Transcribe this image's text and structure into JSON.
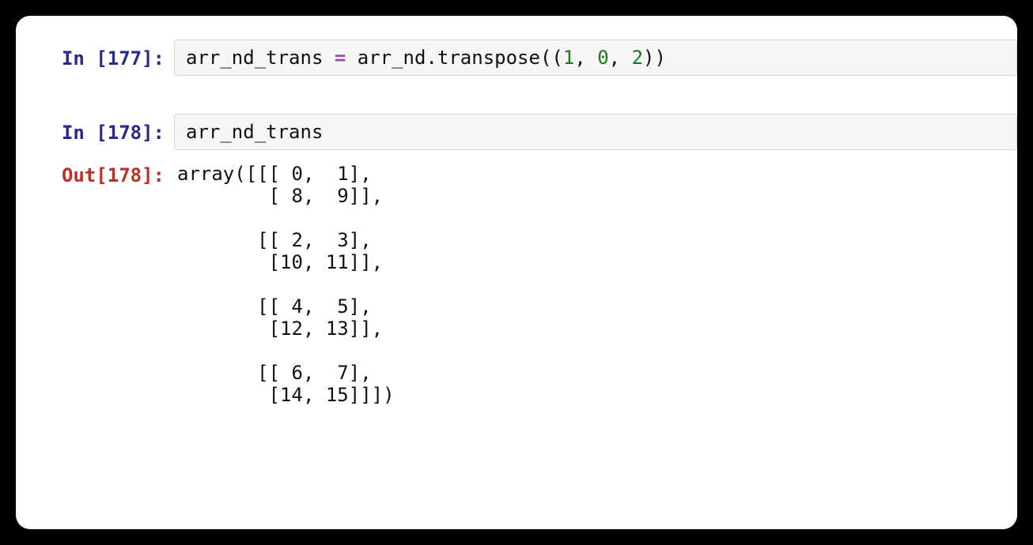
{
  "cells": {
    "c0": {
      "inPrompt": "In [177]:",
      "code": {
        "assign_lhs": "arr_nd_trans",
        "eq": " = ",
        "rhs_obj": "arr_nd",
        "dot": ".",
        "method": "transpose",
        "paren_open": "((",
        "n1": "1",
        "comma1": ", ",
        "n2": "0",
        "comma2": ", ",
        "n3": "2",
        "paren_close": "))"
      }
    },
    "c1": {
      "inPrompt": "In [178]:",
      "code": {
        "expr": "arr_nd_trans"
      }
    },
    "c2": {
      "outPrompt": "Out[178]:",
      "output": "array([[[ 0,  1],\n        [ 8,  9]],\n\n       [[ 2,  3],\n        [10, 11]],\n\n       [[ 4,  5],\n        [12, 13]],\n\n       [[ 6,  7],\n        [14, 15]]])"
    }
  }
}
